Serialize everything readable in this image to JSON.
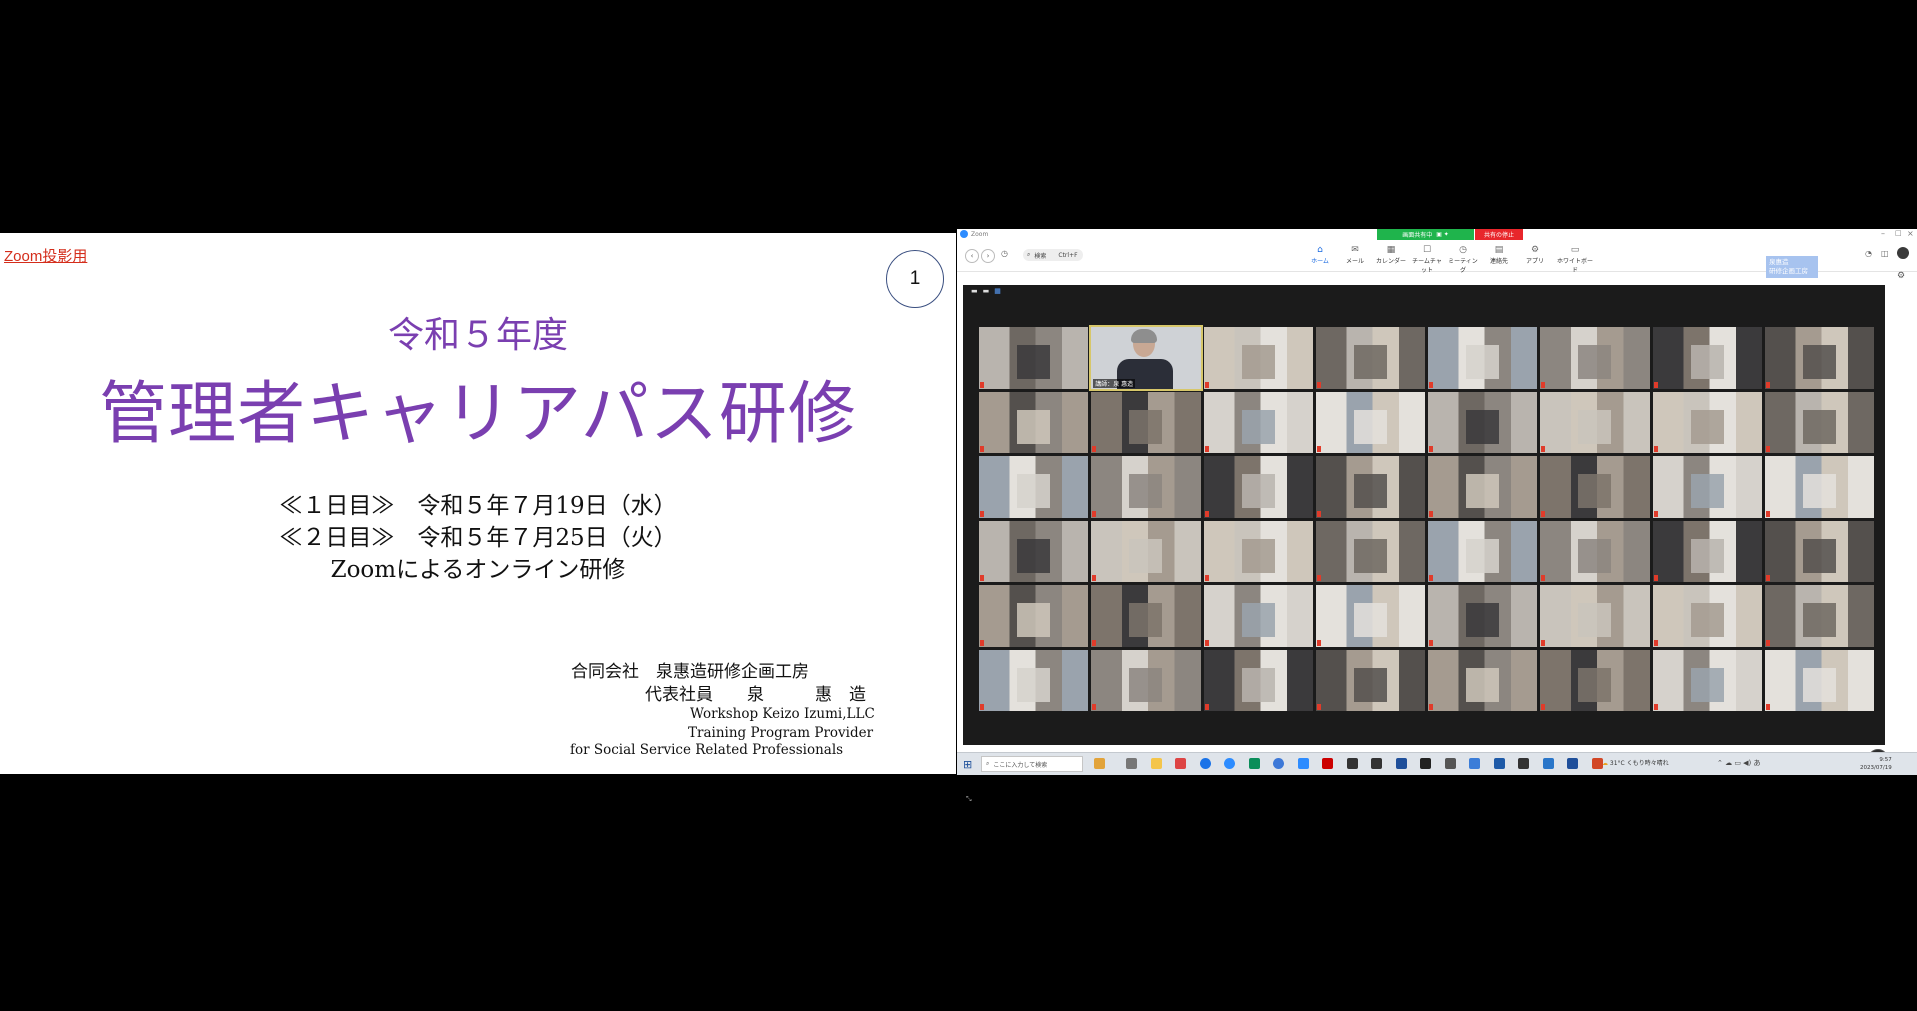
{
  "slide": {
    "link_label": "Zoom投影用",
    "page_number": "1",
    "year": "令和５年度",
    "title": "管理者キャリアパス研修",
    "day1": "≪１日目≫　令和５年７月19日（水）",
    "day2": "≪２日目≫　令和５年７月25日（火）",
    "format": "Zoomによるオンライン研修",
    "company": "合同会社　泉惠造研修企画工房",
    "rep": "代表社員　　泉　　　惠　造",
    "en1": "Workshop Keizo Izumi,LLC",
    "en2": "Training Program Provider",
    "en3": "for Social Service Related Professionals"
  },
  "zoom": {
    "window_title": "Zoom",
    "share_status": "画面共有中",
    "stop_share": "共有の停止",
    "search_placeholder": "検索",
    "search_shortcut": "Ctrl+F",
    "tools": [
      "ホーム",
      "メール",
      "カレンダー",
      "チームチャット",
      "ミーティング",
      "連絡先",
      "アプリ",
      "ホワイトボード"
    ],
    "name_tag_line1": "泉惠造",
    "name_tag_line2": "研修企画工房",
    "speaker_label": "講師：泉 惠造"
  },
  "taskbar": {
    "search_placeholder": "ここに入力して検索",
    "weather": "31°C  くもり時々晴れ",
    "time": "9:57",
    "date": "2023/07/19"
  },
  "colors": {
    "title_purple": "#7a3fb0",
    "link_red": "#d42d1b",
    "share_green": "#1fb44c",
    "stop_red": "#e8262b",
    "zoom_blue": "#1a6ae0"
  }
}
